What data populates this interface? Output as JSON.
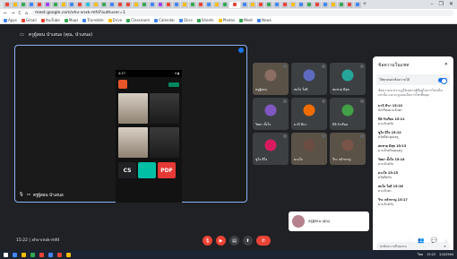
{
  "colors": {
    "meet_bg": "#202124",
    "accent": "#1a73e8",
    "end_call": "#ea4335",
    "panel_bg": "#ffffff"
  },
  "browser": {
    "tab_colors": [
      "#ea4335",
      "#fbbc04",
      "#34a853",
      "#4285f4",
      "#ea4335",
      "#a142f4",
      "#34a853",
      "#fbbc04",
      "#4285f4",
      "#ea4335",
      "#24c1e0",
      "#fbbc04",
      "#34a853",
      "#4285f4",
      "#ea4335",
      "#ea4335",
      "#fbbc04",
      "#34a853",
      "#4285f4",
      "#a142f4",
      "#ea4335",
      "#4285f4",
      "#fbbc04",
      "#34a853",
      "#ea4335",
      "#4285f4",
      "#fbbc04",
      "#34a853",
      "#ea4335",
      "#4285f4",
      "#fbbc04",
      "#ea4335",
      "#34a853",
      "#4285f4",
      "#ea4335",
      "#fbbc04",
      "#4285f4",
      "#34a853",
      "#ea4335",
      "#4285f4",
      "#fbbc04",
      "#34a853",
      "#ea4335",
      "#4285f4"
    ],
    "new_tab": "+",
    "window_controls": [
      "–",
      "❐",
      "✕"
    ],
    "nav": {
      "back": "←",
      "forward": "→",
      "reload": "C",
      "home": "⌂"
    },
    "url": "meet.google.com/xhv-vnxk-mfd?authuser=1",
    "bookmarks": [
      {
        "label": "Apps",
        "color": "#4285f4"
      },
      {
        "label": "Gmail",
        "color": "#ea4335"
      },
      {
        "label": "YouTube",
        "color": "#ea4335"
      },
      {
        "label": "Maps",
        "color": "#34a853"
      },
      {
        "label": "Translate",
        "color": "#4285f4"
      },
      {
        "label": "Drive",
        "color": "#fbbc04"
      },
      {
        "label": "Classroom",
        "color": "#34a853"
      },
      {
        "label": "Calendar",
        "color": "#4285f4"
      },
      {
        "label": "Docs",
        "color": "#4285f4"
      },
      {
        "label": "Sheets",
        "color": "#34a853"
      },
      {
        "label": "Photos",
        "color": "#fbbc04"
      },
      {
        "label": "Meet",
        "color": "#34a853"
      },
      {
        "label": "News",
        "color": "#4285f4"
      }
    ]
  },
  "meeting": {
    "title": "ครูผู้สอน นำเสนอ (คุณ, นำเสนอ)",
    "presenter_label": "ครูผู้สอน นำเสนอ",
    "time_label": "15:22 | xhv-vnxk-mfd",
    "self_name": "ครูผู้สอน (คุณ)",
    "phone": {
      "status_time": "4:27",
      "status_icons": "▾ ▮",
      "chip_labels": [
        "CS",
        "",
        "PDF"
      ],
      "chip_colors": [
        "#202124",
        "#00bfa5",
        "#e53935"
      ]
    },
    "participants": [
      {
        "name": "ครูผู้สอน",
        "avatar": "#8d6e63",
        "video": true
      },
      {
        "name": "สมใจ ใจดี",
        "avatar": "#5c6bc0",
        "video": false
      },
      {
        "name": "สมชาย มีสุข",
        "avatar": "#26a69a",
        "video": false
      },
      {
        "name": "วิทยา ตั้งใจ",
        "avatar": "#7e57c2",
        "video": false
      },
      {
        "name": "มานี มีนา",
        "avatar": "#ef6c00",
        "video": false
      },
      {
        "name": "ปิติ รักเรียน",
        "avatar": "#43a047",
        "video": false
      },
      {
        "name": "ชูใจ ดีใจ",
        "avatar": "#d81b60",
        "video": false
      },
      {
        "name": "ดวงใจ",
        "avatar": "#6d4c41",
        "video": true
      },
      {
        "name": "วีระ กล้าหาญ",
        "avatar": "#795548",
        "video": true
      }
    ]
  },
  "chat": {
    "title": "ข้อความในแชท",
    "close": "✕",
    "toggle_label": "ให้ทุกคนส่งข้อความได้",
    "note": "ข้อความจะปรากฏให้เฉพาะผู้ที่อยู่ในการโทรเห็นเท่านั้น และจะถูกลบเมื่อการโทรสิ้นสุด",
    "messages": [
      {
        "sender": "มานี มีนา 15:10",
        "text": "นักเรียนมาแล้วค่ะ"
      },
      {
        "sender": "ปิติ รักเรียน 15:11",
        "text": "มาแล้วครับ"
      },
      {
        "sender": "ชูใจ ดีใจ 15:12",
        "text": "สวัสดีค่ะคุณครู"
      },
      {
        "sender": "สมชาย มีสุข 15:13",
        "text": "มาแล้วครับคุณครู"
      },
      {
        "sender": "วิทยา ตั้งใจ 15:14",
        "text": "มาแล้วครับ"
      },
      {
        "sender": "ดวงใจ 15:15",
        "text": "สวัสดีครับ"
      },
      {
        "sender": "สมใจ ใจดี 15:16",
        "text": "มาแล้วค่ะ"
      },
      {
        "sender": "วีระ กล้าหาญ 15:17",
        "text": "มาแล้วครับ"
      }
    ],
    "input_placeholder": "ส่งข้อความถึงทุกคน",
    "send_icon": "➤"
  },
  "controls": {
    "mic": "🎙",
    "camera": "▶",
    "captions": "▤",
    "present": "⬆",
    "end": "✆",
    "right_icons": [
      "ⓘ",
      "👥",
      "💬",
      "▲"
    ]
  },
  "taskbar": {
    "icon_colors": [
      "#ffffff",
      "#4285f4",
      "#fbbc04",
      "#34a853",
      "#ea4335",
      "#4285f4",
      "#ea4335",
      "#fbbc04"
    ],
    "lang": "ไทย",
    "time": "15:22",
    "date": "2/4/2564"
  }
}
